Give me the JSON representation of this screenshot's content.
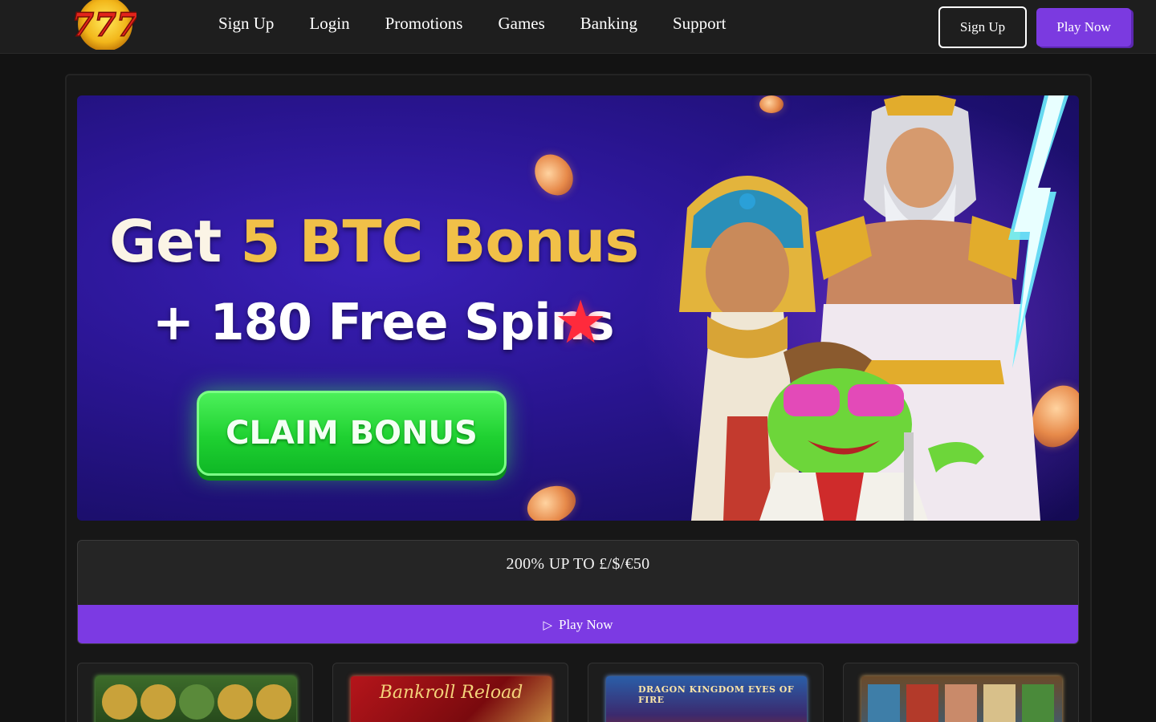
{
  "header": {
    "logo_text": "777",
    "nav": [
      "Sign Up",
      "Login",
      "Promotions",
      "Games",
      "Banking",
      "Support"
    ],
    "signup_button": "Sign Up",
    "play_button": "Play Now"
  },
  "banner": {
    "get": "Get",
    "bonus_amount": "5 BTC Bonus",
    "free_spins": "+ 180 Free Spins",
    "claim_button": "CLAIM BONUS"
  },
  "offer": {
    "title": "200% UP TO £/$/€50",
    "play_label": "Play Now"
  },
  "games": [
    {
      "thumb_text": ""
    },
    {
      "thumb_text": "Bankroll Reload"
    },
    {
      "thumb_text": "DRAGON KINGDOM EYES OF FIRE"
    },
    {
      "thumb_text": ""
    }
  ],
  "icons": {
    "play": "play-icon",
    "star": "star-icon"
  },
  "colors": {
    "accent_purple": "#7c3ae3",
    "claim_green": "#1fd131",
    "gold": "#f1c048",
    "background": "#131313"
  }
}
